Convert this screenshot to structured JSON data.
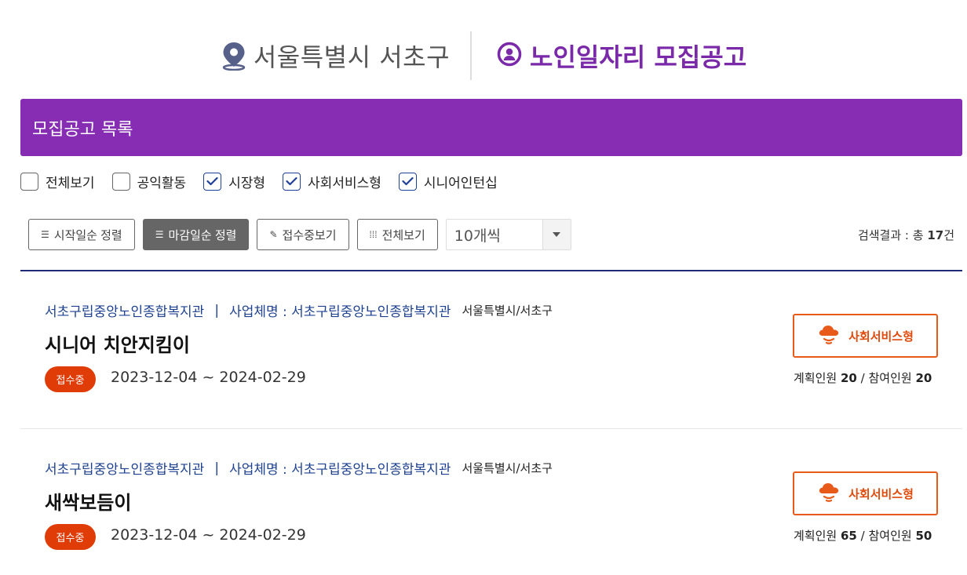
{
  "header": {
    "region": "서울특별시 서초구",
    "brand": "노인일자리 모집공고",
    "pin_icon": "location-pin-icon",
    "brand_icon": "person-circle-icon"
  },
  "section": {
    "title": "모집공고 목록"
  },
  "filters": [
    {
      "label": "전체보기",
      "checked": false
    },
    {
      "label": "공익활동",
      "checked": false
    },
    {
      "label": "시장형",
      "checked": true
    },
    {
      "label": "사회서비스형",
      "checked": true
    },
    {
      "label": "시니어인턴십",
      "checked": true
    }
  ],
  "toolbar": {
    "sort_start_label": "시작일순 정렬",
    "sort_end_label": "마감일순 정렬",
    "accepting_label": "접수중보기",
    "view_all_label": "전체보기",
    "page_size_value": "10개씩",
    "result_prefix": "검색결과 : 총 ",
    "result_count": "17",
    "result_suffix": "건"
  },
  "colors": {
    "brand_purple": "#862db3",
    "brand_text": "#7a2aa9",
    "status_orange": "#e03c08",
    "link_blue": "#1f4290"
  },
  "items": [
    {
      "org": "서초구립중앙노인종합복지관",
      "separator": "|",
      "business_label": "사업체명 : 서초구립중앙노인종합복지관",
      "location": "서울특별시/서초구",
      "title": "시니어 치안지킴이",
      "status": "접수중",
      "period": "2023-12-04 ~ 2024-02-29",
      "type": "사회서비스형",
      "planned_label": "계획인원",
      "planned": "20",
      "count_sep": "/",
      "joined_label": "참여인원",
      "joined": "20"
    },
    {
      "org": "서초구립중앙노인종합복지관",
      "separator": "|",
      "business_label": "사업체명 : 서초구립중앙노인종합복지관",
      "location": "서울특별시/서초구",
      "title": "새싹보듬이",
      "status": "접수중",
      "period": "2023-12-04 ~ 2024-02-29",
      "type": "사회서비스형",
      "planned_label": "계획인원",
      "planned": "65",
      "count_sep": "/",
      "joined_label": "참여인원",
      "joined": "50"
    }
  ]
}
